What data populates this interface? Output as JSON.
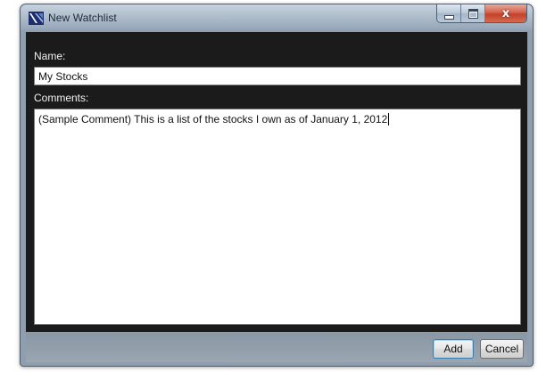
{
  "window": {
    "title": "New Watchlist",
    "icon": "app-logo-icon"
  },
  "caption_buttons": {
    "minimize_icon": "minimize-icon",
    "maximize_icon": "maximize-icon",
    "close_glyph": "x",
    "close_icon": "close-icon"
  },
  "form": {
    "name_label": "Name:",
    "name_value": "My Stocks",
    "comments_label": "Comments:",
    "comments_value": "(Sample Comment) This is a list of the stocks I own as of January 1, 2012"
  },
  "footer": {
    "add_label": "Add",
    "cancel_label": "Cancel"
  },
  "colors": {
    "client_background": "#1b1b1b",
    "accent_blue": "#3c7fb1",
    "close_red": "#c4412a",
    "title_text": "#1d2a38"
  }
}
